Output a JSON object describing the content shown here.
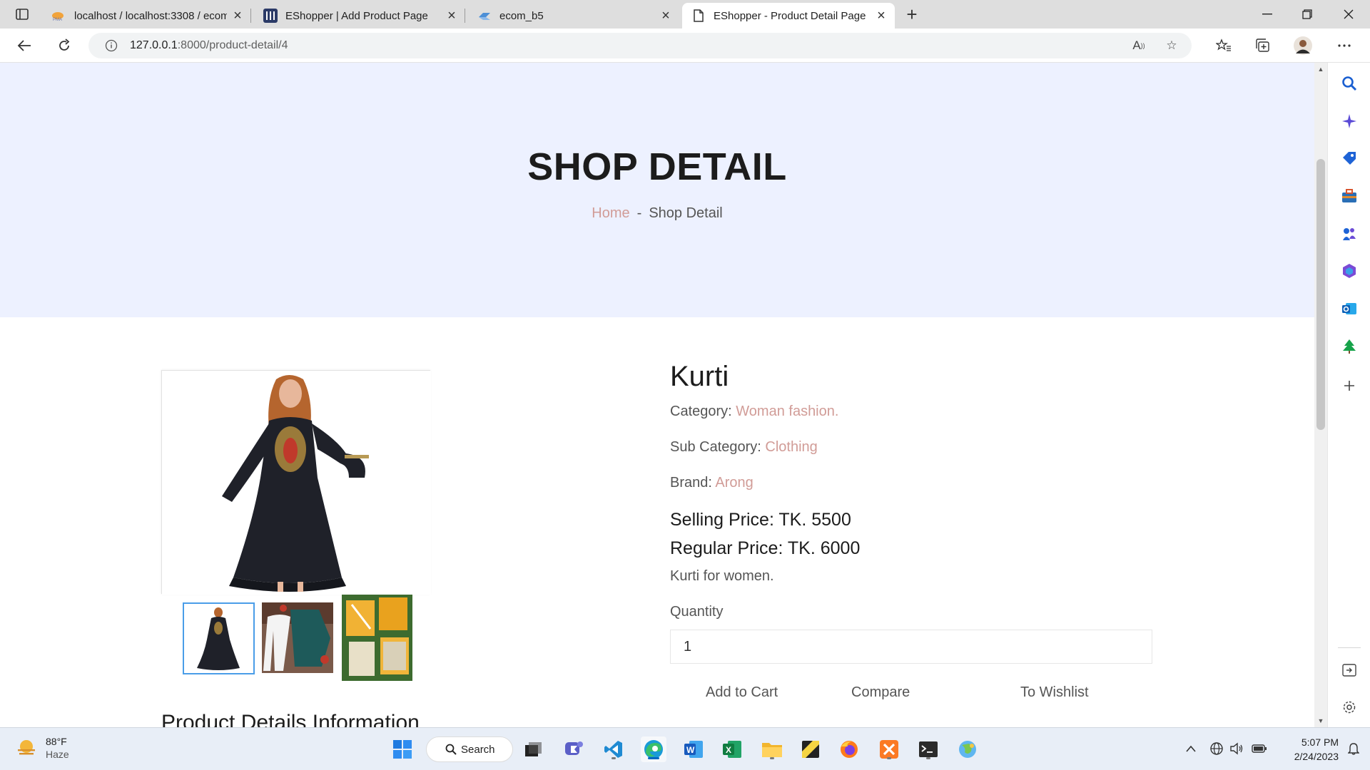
{
  "browser": {
    "tabs": [
      {
        "label": "localhost / localhost:3308 / ecom",
        "icon": "phpmyadmin-icon"
      },
      {
        "label": "EShopper | Add Product Page",
        "icon": "site-logo-icon"
      },
      {
        "label": "ecom_b5",
        "icon": "vscode-tab-icon"
      },
      {
        "label": "EShopper - Product Detail Page",
        "icon": "page-icon"
      }
    ],
    "url_host": "127.0.0.1",
    "url_rest": ":8000/product-detail/4"
  },
  "hero": {
    "title": "SHOP DETAIL",
    "breadcrumb_home": "Home",
    "breadcrumb_sep": "-",
    "breadcrumb_current": "Shop Detail"
  },
  "product": {
    "name": "Kurti",
    "category_label": "Category:",
    "category": "Woman fashion.",
    "subcategory_label": "Sub Category:",
    "subcategory": "Clothing",
    "brand_label": "Brand:",
    "brand": "Arong",
    "selling_price": "Selling Price: TK. 5500",
    "regular_price": "Regular Price: TK. 6000",
    "description": "Kurti for women.",
    "quantity_label": "Quantity",
    "quantity_value": "1",
    "actions": {
      "add_to_cart": "Add to Cart",
      "compare": "Compare",
      "wishlist": "To Wishlist"
    },
    "details_heading": "Product Details Information"
  },
  "taskbar": {
    "weather_temp": "88°F",
    "weather_cond": "Haze",
    "search_label": "Search",
    "time": "5:07 PM",
    "date": "2/24/2023"
  },
  "colors": {
    "accent": "#d19c97",
    "hero_bg": "#edf1ff"
  }
}
